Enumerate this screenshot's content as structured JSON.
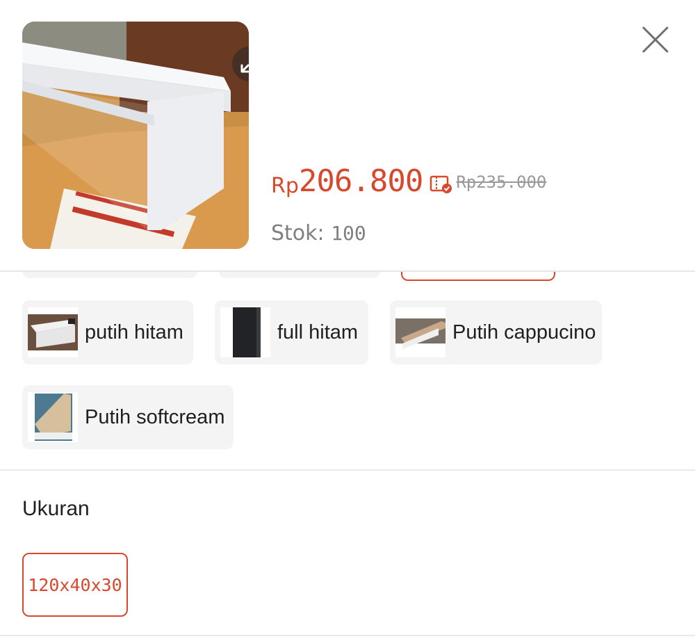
{
  "header": {
    "price_currency": "Rp",
    "price_value": "206.800",
    "price_old": "Rp235.000",
    "stock_label": "Stok:",
    "stock_value": "100"
  },
  "icons": {
    "expand": "expand-icon",
    "close": "close-icon",
    "coupon": "coupon-icon"
  },
  "variants": [
    {
      "label": "putih hitam"
    },
    {
      "label": "full hitam"
    },
    {
      "label": "Putih cappucino"
    },
    {
      "label": "Putih softcream"
    }
  ],
  "size_section": {
    "title": "Ukuran",
    "options": [
      {
        "label": "120x40x30",
        "selected": true
      }
    ]
  },
  "colors": {
    "accent": "#d8482b",
    "chip_bg": "#f4f4f4"
  }
}
